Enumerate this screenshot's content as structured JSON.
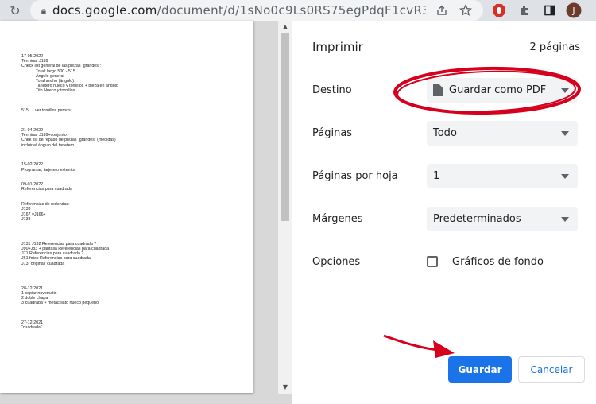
{
  "browser": {
    "url_host": "docs.google.com",
    "url_path": "/document/d/1sNo0c9Ls0RS75egPdqF1cvR30RDG9Mc5...",
    "profile_initial": "J"
  },
  "doc_lines": [
    {
      "t": "17-05-2022"
    },
    {
      "t": "Terminar J189"
    },
    {
      "t": "Check list general de las piezas “grandes”:"
    },
    {
      "t": "Total: largo 500 - 515",
      "li": true
    },
    {
      "t": "Ángulo general",
      "li": true
    },
    {
      "t": "Total ancho (ángulo)",
      "li": true
    },
    {
      "t": "Tarjetero hueco y tornillos + pieza en ángulo",
      "li": true
    },
    {
      "t": "Tito Hueco y tornillos",
      "li": true
    },
    {
      "t": ""
    },
    {
      "t": ""
    },
    {
      "t": ""
    },
    {
      "t": "515 → ver tornillos pernos"
    },
    {
      "t": ""
    },
    {
      "t": ""
    },
    {
      "t": ""
    },
    {
      "t": "21-04-2022"
    },
    {
      "t": "Terminar J189+conjunto"
    },
    {
      "t": "Chek list de repaso de piezas “grandes” (medidas)"
    },
    {
      "t": "incluir el ángulo del tarjetero"
    },
    {
      "t": ""
    },
    {
      "t": ""
    },
    {
      "t": ""
    },
    {
      "t": "15-02-2022"
    },
    {
      "t": "Programar, tarjetero exterrior"
    },
    {
      "t": ""
    },
    {
      "t": ""
    },
    {
      "t": "09-01-2022"
    },
    {
      "t": "Referencias para cuadrada"
    },
    {
      "t": ""
    },
    {
      "t": ""
    },
    {
      "t": "Referencias  de redondas:"
    },
    {
      "t": "J133"
    },
    {
      "t": "J167 =J166+"
    },
    {
      "t": "J133"
    },
    {
      "t": ""
    },
    {
      "t": ""
    },
    {
      "t": ""
    },
    {
      "t": ""
    },
    {
      "t": "J131 J132  Referencias para cuadrada ?"
    },
    {
      "t": "J90+J83 + pantalla Referencias para cuadrada"
    },
    {
      "t": "J71 Referencias para cuadrada ?"
    },
    {
      "t": "J61 fotos Referencias para cuadrada"
    },
    {
      "t": "J13 “original”  cuadrada"
    },
    {
      "t": ""
    },
    {
      "t": ""
    },
    {
      "t": ""
    },
    {
      "t": ""
    },
    {
      "t": "28-12-2021"
    },
    {
      "t": "1 copiar novomatic"
    },
    {
      "t": "2 doble chapa"
    },
    {
      "t": "3”cuadrada”+ metacrilato hueco pequeño"
    },
    {
      "t": ""
    },
    {
      "t": ""
    },
    {
      "t": ""
    },
    {
      "t": "27-12-2021"
    },
    {
      "t": "“cuadrada”"
    }
  ],
  "print": {
    "title": "Imprimir",
    "pages_count": "2 páginas",
    "destination_label": "Destino",
    "destination_value": "Guardar como PDF",
    "pages_label": "Páginas",
    "pages_value": "Todo",
    "per_sheet_label": "Páginas por hoja",
    "per_sheet_value": "1",
    "margins_label": "Márgenes",
    "margins_value": "Predeterminados",
    "options_label": "Opciones",
    "background_graphics_label": "Gráficos de fondo",
    "background_graphics_checked": false,
    "save_button": "Guardar",
    "cancel_button": "Cancelar"
  },
  "colors": {
    "accent": "#1a73e8",
    "annotation": "#d6001c"
  }
}
